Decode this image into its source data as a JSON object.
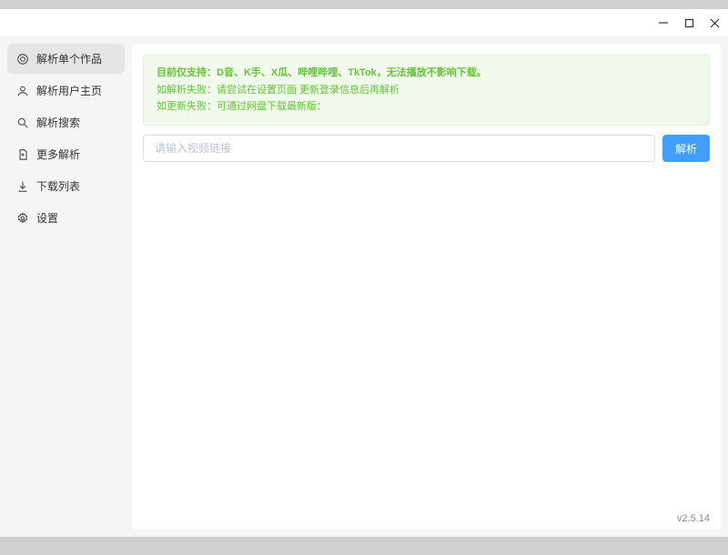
{
  "window": {
    "minimize": "—",
    "maximize": "□",
    "close": "✕"
  },
  "sidebar": {
    "items": [
      {
        "label": "解析单个作品"
      },
      {
        "label": "解析用户主页"
      },
      {
        "label": "解析搜索"
      },
      {
        "label": "更多解析"
      },
      {
        "label": "下载列表"
      },
      {
        "label": "设置"
      }
    ]
  },
  "notice": {
    "line1": "目前仅支持：D音、K手、X瓜、哔哩哔哩、TkTok，无法播放不影响下载。",
    "line2": "如解析失败：请尝试在设置页面 更新登录信息后再解析",
    "line3": "如更新失败：可通过网盘下载最新版："
  },
  "input": {
    "placeholder": "请输入视频链接"
  },
  "actions": {
    "parse": "解析"
  },
  "version": "v2.5.14"
}
